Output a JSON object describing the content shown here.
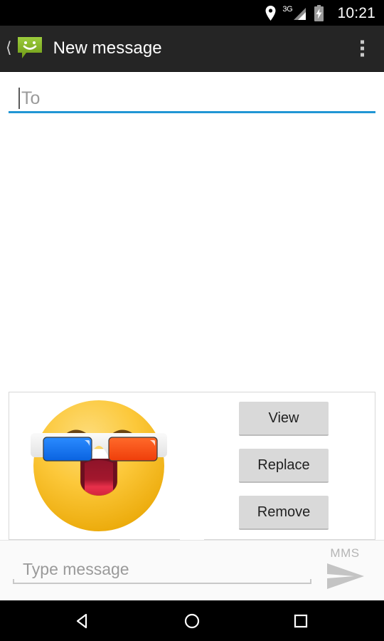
{
  "status_bar": {
    "location_icon": "location-pin-icon",
    "network_type": "3G",
    "signal_icon": "signal-bars-icon",
    "battery_icon": "battery-charging-icon",
    "time": "10:21"
  },
  "app_bar": {
    "back_icon": "back-chevron-icon",
    "app_icon": "messaging-app-icon",
    "title": "New message",
    "overflow_icon": "overflow-menu-icon"
  },
  "recipient_field": {
    "placeholder": "To",
    "value": "",
    "focused": true,
    "underline_color": "#2196d4"
  },
  "attachment": {
    "preview_icon": "emoji-3d-glasses-face",
    "buttons": [
      {
        "label": "View",
        "name": "view-button"
      },
      {
        "label": "Replace",
        "name": "replace-button"
      },
      {
        "label": "Remove",
        "name": "remove-button"
      }
    ]
  },
  "compose_bar": {
    "placeholder": "Type message",
    "value": "",
    "mms_label": "MMS",
    "send_icon": "send-arrow-icon"
  },
  "nav_bar": {
    "back": "nav-back-triangle-icon",
    "home": "nav-home-circle-icon",
    "recents": "nav-recents-square-icon"
  },
  "colors": {
    "status_bar_bg": "#000000",
    "app_bar_bg": "#252525",
    "accent_blue": "#2196d4",
    "app_icon_green": "#8bc34a",
    "button_gray": "#d9d9d9",
    "emoji_yellow": "#fcc21b",
    "lens_blue": "#1877f2",
    "lens_orange": "#f4511e"
  }
}
